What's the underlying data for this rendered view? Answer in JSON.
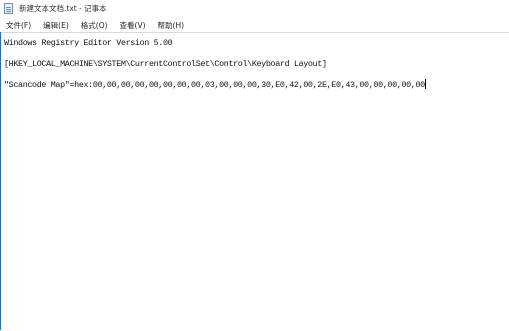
{
  "window": {
    "title": "新建文本文档.txt - 记事本",
    "app_icon": "notepad-icon"
  },
  "menu": [
    {
      "label": "文件(F)"
    },
    {
      "label": "编辑(E)"
    },
    {
      "label": "格式(O)"
    },
    {
      "label": "查看(V)"
    },
    {
      "label": "帮助(H)"
    }
  ],
  "editor": {
    "lines": [
      "Windows Registry Editor Version 5.00",
      "[HKEY_LOCAL_MACHINE\\SYSTEM\\CurrentControlSet\\Control\\Keyboard Layout]",
      "\"Scancode Map\"=hex:00,00,00,00,00,00,00,00,03,00,00,00,30,E0,42,00,2E,E0,43,00,00,00,00,00"
    ]
  },
  "colors": {
    "accent_border": "#1e6fd9"
  }
}
